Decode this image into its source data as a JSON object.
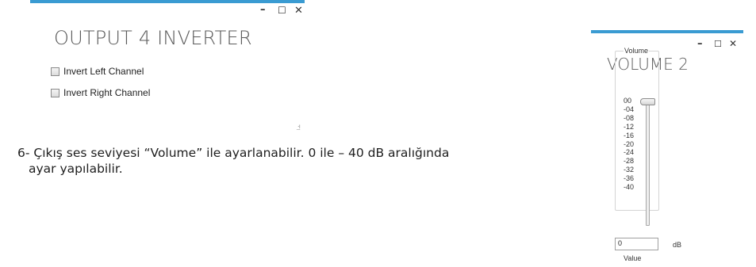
{
  "window1": {
    "title": "OUTPUT 4 INVERTER",
    "controls": {
      "minimize": "–",
      "maximize": "☐",
      "close": "✕"
    },
    "checkboxes": [
      {
        "label": "Invert Left Channel",
        "checked": false
      },
      {
        "label": "Invert Right Channel",
        "checked": false
      }
    ],
    "resize_grip": ".:!"
  },
  "paragraph": {
    "line1": "6- Çıkış ses seviyesi “Volume” ile ayarlanabilir. 0 ile – 40 dB aralığında",
    "line2": "ayar yapılabilir."
  },
  "window2": {
    "title": "VOLUME 2",
    "controls": {
      "minimize": "–",
      "maximize": "☐",
      "close": "✕"
    },
    "group_label": "Volume",
    "scale_ticks": [
      "00",
      "-04",
      "-08",
      "-12",
      "-16",
      "-20",
      "-24",
      "-28",
      "-32",
      "-36",
      "-40"
    ],
    "slider_value_db": 0,
    "value_input": "0",
    "unit": "dB",
    "value_label": "Value"
  },
  "colors": {
    "titlebar_accent": "#3a9bd2"
  }
}
